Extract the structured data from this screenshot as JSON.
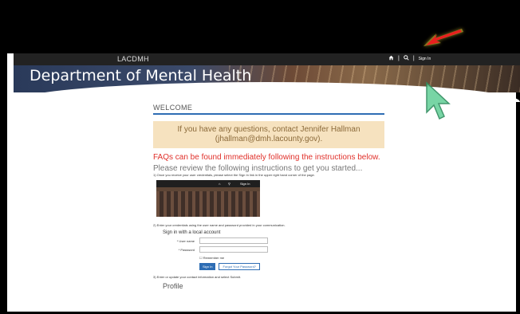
{
  "header": {
    "brand": "LACDMH",
    "nav": {
      "home_icon": "home-icon",
      "sep1": "|",
      "search_icon": "search-icon",
      "sep2": "|",
      "signin": "Sign In"
    }
  },
  "banner": {
    "title": "Department of Mental Health"
  },
  "content": {
    "welcome": "WELCOME",
    "question_line1": "If you have any questions, contact Jennifer Hallman",
    "question_line2": "(jhallman@dmh.lacounty.gov).",
    "faq": "FAQs can be found immediately following the instructions below.",
    "review": "Please review the following instructions to get you started...",
    "step1": "1) Once you receive your user credentials, please select the Sign In link in the upper right hand corner of the page.",
    "screenshot": {
      "signin": "Sign In"
    },
    "step2": "2) Enter your credentials using the user name and password provided in your communication.",
    "signin_heading": "Sign in with a local account",
    "username_label": "* User name",
    "password_label": "* Password",
    "remember": "Remember me",
    "signin_button": "Sign In",
    "forgot_button": "Forgot Your Password?",
    "step3": "3) Enter or update your contact information and select Submit.",
    "profile": "Profile"
  },
  "annotations": {
    "arrow_color": "#e8201f",
    "cursor_color": "#4fc08a"
  }
}
